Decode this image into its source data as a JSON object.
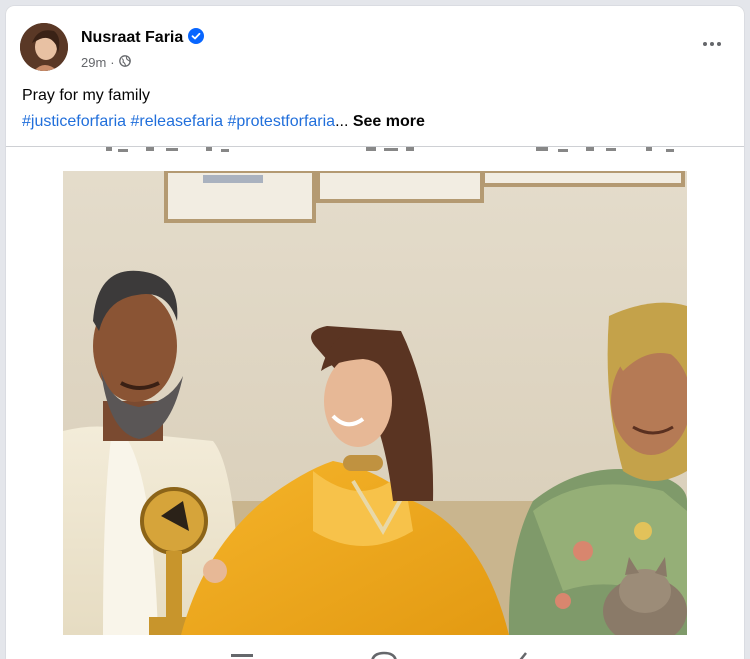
{
  "post": {
    "author": "Nusraat Faria",
    "time": "29m",
    "separator": "·",
    "text_line1": "Pray for my family",
    "hashtags": [
      "#justiceforfaria",
      "#releasefaria",
      "#protestforfaria"
    ],
    "ellipsis": "...",
    "see_more": "See more"
  },
  "colors": {
    "hashtag": "#216fdb",
    "verified": "#0866ff",
    "dupatta": "#f0a818"
  },
  "icons": {
    "verified": "verified-badge-icon",
    "privacy": "globe-icon",
    "more": "more-options-icon"
  }
}
